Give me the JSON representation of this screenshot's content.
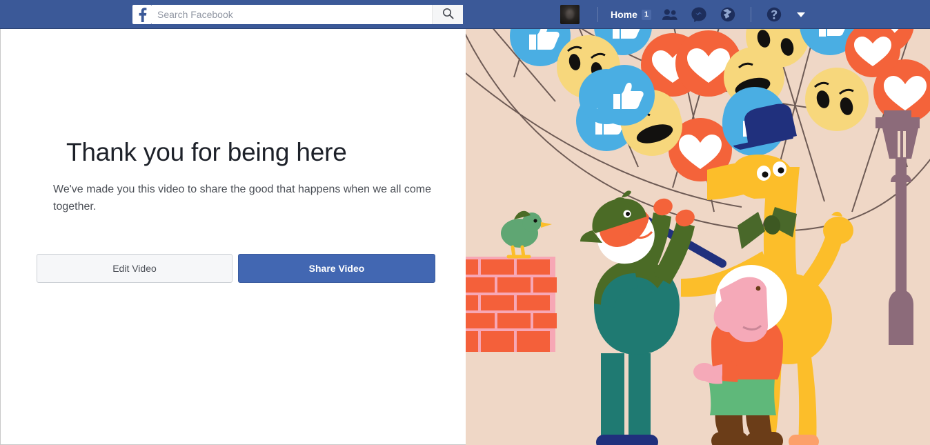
{
  "header": {
    "logo_icon": "facebook-f-logo",
    "search": {
      "placeholder": "Search Facebook",
      "value": "",
      "icon": "search-icon"
    },
    "avatar": {
      "icon": "user-avatar",
      "alt": ""
    },
    "home": {
      "label": "Home",
      "badge": "1"
    },
    "icons": [
      {
        "name": "friend-requests-icon",
        "glyph": "friends"
      },
      {
        "name": "messages-icon",
        "glyph": "messenger"
      },
      {
        "name": "notifications-icon",
        "glyph": "globe"
      },
      {
        "name": "help-icon",
        "glyph": "question"
      }
    ],
    "account_menu_icon": "chevron-down-icon",
    "bg_color": "#3b5998"
  },
  "main": {
    "title": "Thank you for being here",
    "description": "We've made you this video to share the good that happens when we all come together.",
    "buttons": {
      "edit": "Edit Video",
      "share": "Share Video"
    },
    "primary_color": "#4267b2"
  },
  "illustration": {
    "name": "friends-day-celebration-illustration",
    "background_color": "#EFD7C6",
    "elements": [
      "reaction-balloons-canopy",
      "giraffe-character-with-top-hat",
      "conductor-baton",
      "green-outfit-character",
      "pink-character-with-white-hair",
      "brick-wall",
      "green-bird",
      "street-lamp"
    ],
    "reaction_colors": {
      "like_blue": "#4AAEE3",
      "love_red": "#F4633A",
      "haha_yellow": "#F7D77C",
      "net_line": "#6E5B55"
    },
    "character_colors": {
      "giraffe_yellow": "#FCBE2A",
      "hat_navy": "#20307D",
      "bowtie_green": "#49682A",
      "teal": "#1F7A72",
      "olive": "#4B6B26",
      "orange": "#F4633A",
      "pink": "#F5A9B8",
      "brown": "#6B3D18",
      "lamp_mauve": "#8C6B7A",
      "brick_orange": "#F4603A",
      "brick_mortar": "#F7A7B5",
      "bird_green": "#5FA673"
    }
  }
}
